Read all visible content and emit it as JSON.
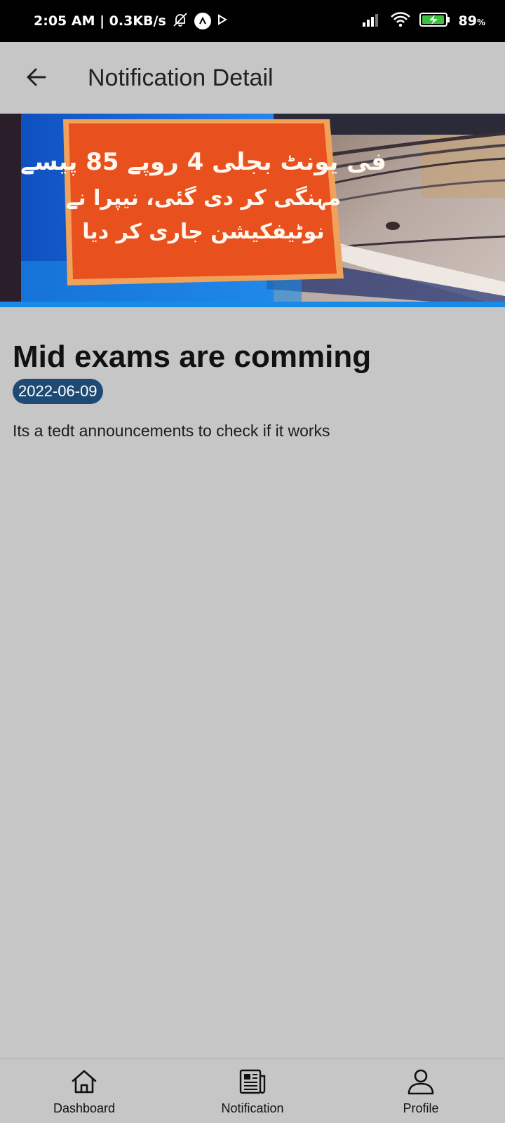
{
  "status_bar": {
    "time_speed": "2:05 AM | 0.3KB/s",
    "battery_value": "89",
    "battery_unit": "%",
    "icons": [
      "mute-bell-icon",
      "vpn-icon",
      "play-icon",
      "signal-icon",
      "wifi-icon",
      "battery-charging-icon"
    ]
  },
  "app_bar": {
    "title": "Notification Detail",
    "back_icon": "arrow-back-icon"
  },
  "banner": {
    "line1": "فی یونٹ بجلی 4 روپے 85 پیسے",
    "line2": "مہنگی کر دی گئی، نیپرا نے",
    "line3": "نوٹیفکیشن جاری کر دیا"
  },
  "notification": {
    "title": "Mid exams are comming",
    "date": "2022-06-09",
    "body": "Its a tedt announcements to check if it works"
  },
  "bottom_nav": {
    "items": [
      {
        "label": "Dashboard",
        "icon": "home-icon"
      },
      {
        "label": "Notification",
        "icon": "newspaper-icon"
      },
      {
        "label": "Profile",
        "icon": "person-icon"
      }
    ]
  },
  "colors": {
    "background": "#c6c6c6",
    "status_bar": "#000000",
    "date_badge": "#1f4a73",
    "banner_orange": "#e8501e",
    "banner_blue": "#1a78e0"
  }
}
